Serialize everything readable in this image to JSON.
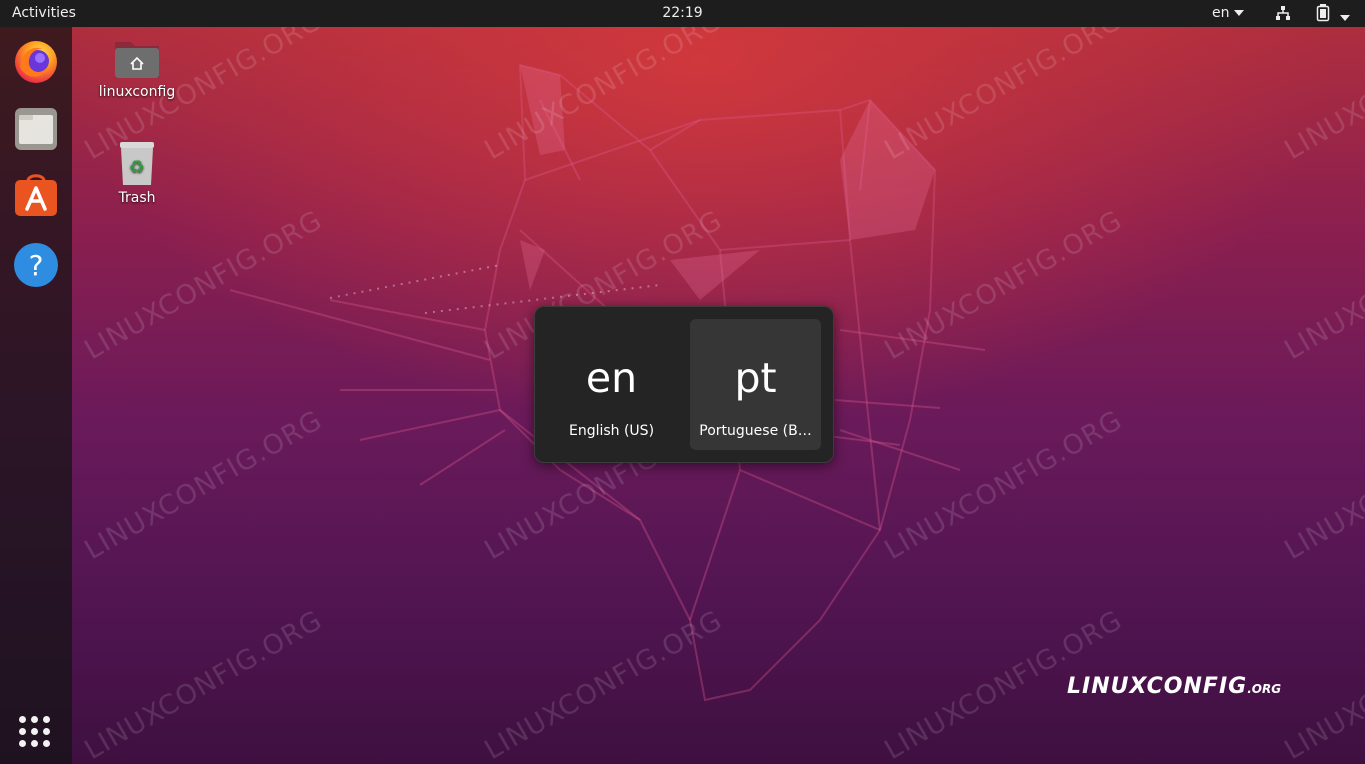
{
  "topbar": {
    "activities_label": "Activities",
    "clock": "22:19",
    "input_source": "en"
  },
  "dock": {
    "items": [
      {
        "name": "Firefox Web Browser",
        "icon": "firefox-icon"
      },
      {
        "name": "Files",
        "icon": "files-icon"
      },
      {
        "name": "Ubuntu Software",
        "icon": "software-center-icon"
      },
      {
        "name": "Help",
        "icon": "help-icon"
      }
    ],
    "show_apps_icon": "app-grid-icon"
  },
  "desktop": {
    "icons": [
      {
        "label": "linuxconfig",
        "icon": "home-folder-icon"
      },
      {
        "label": "Trash",
        "icon": "trash-icon"
      }
    ]
  },
  "input_switcher": {
    "sources": [
      {
        "code": "en",
        "label": "English (US)",
        "selected": false
      },
      {
        "code": "pt",
        "label": "Portuguese (B…",
        "selected": true
      }
    ]
  },
  "watermark": {
    "text": "LINUXCONFIG.ORG"
  },
  "brand": {
    "main": "LINUXCONFIG",
    "suffix": ".ORG"
  },
  "colors": {
    "topbar": "#1d1d1d",
    "switcher_bg": "#242424",
    "switcher_selected": "#363636",
    "ubuntu_orange": "#e95420",
    "wallpaper_top": "#b3303c",
    "wallpaper_bottom": "#3e1040"
  }
}
